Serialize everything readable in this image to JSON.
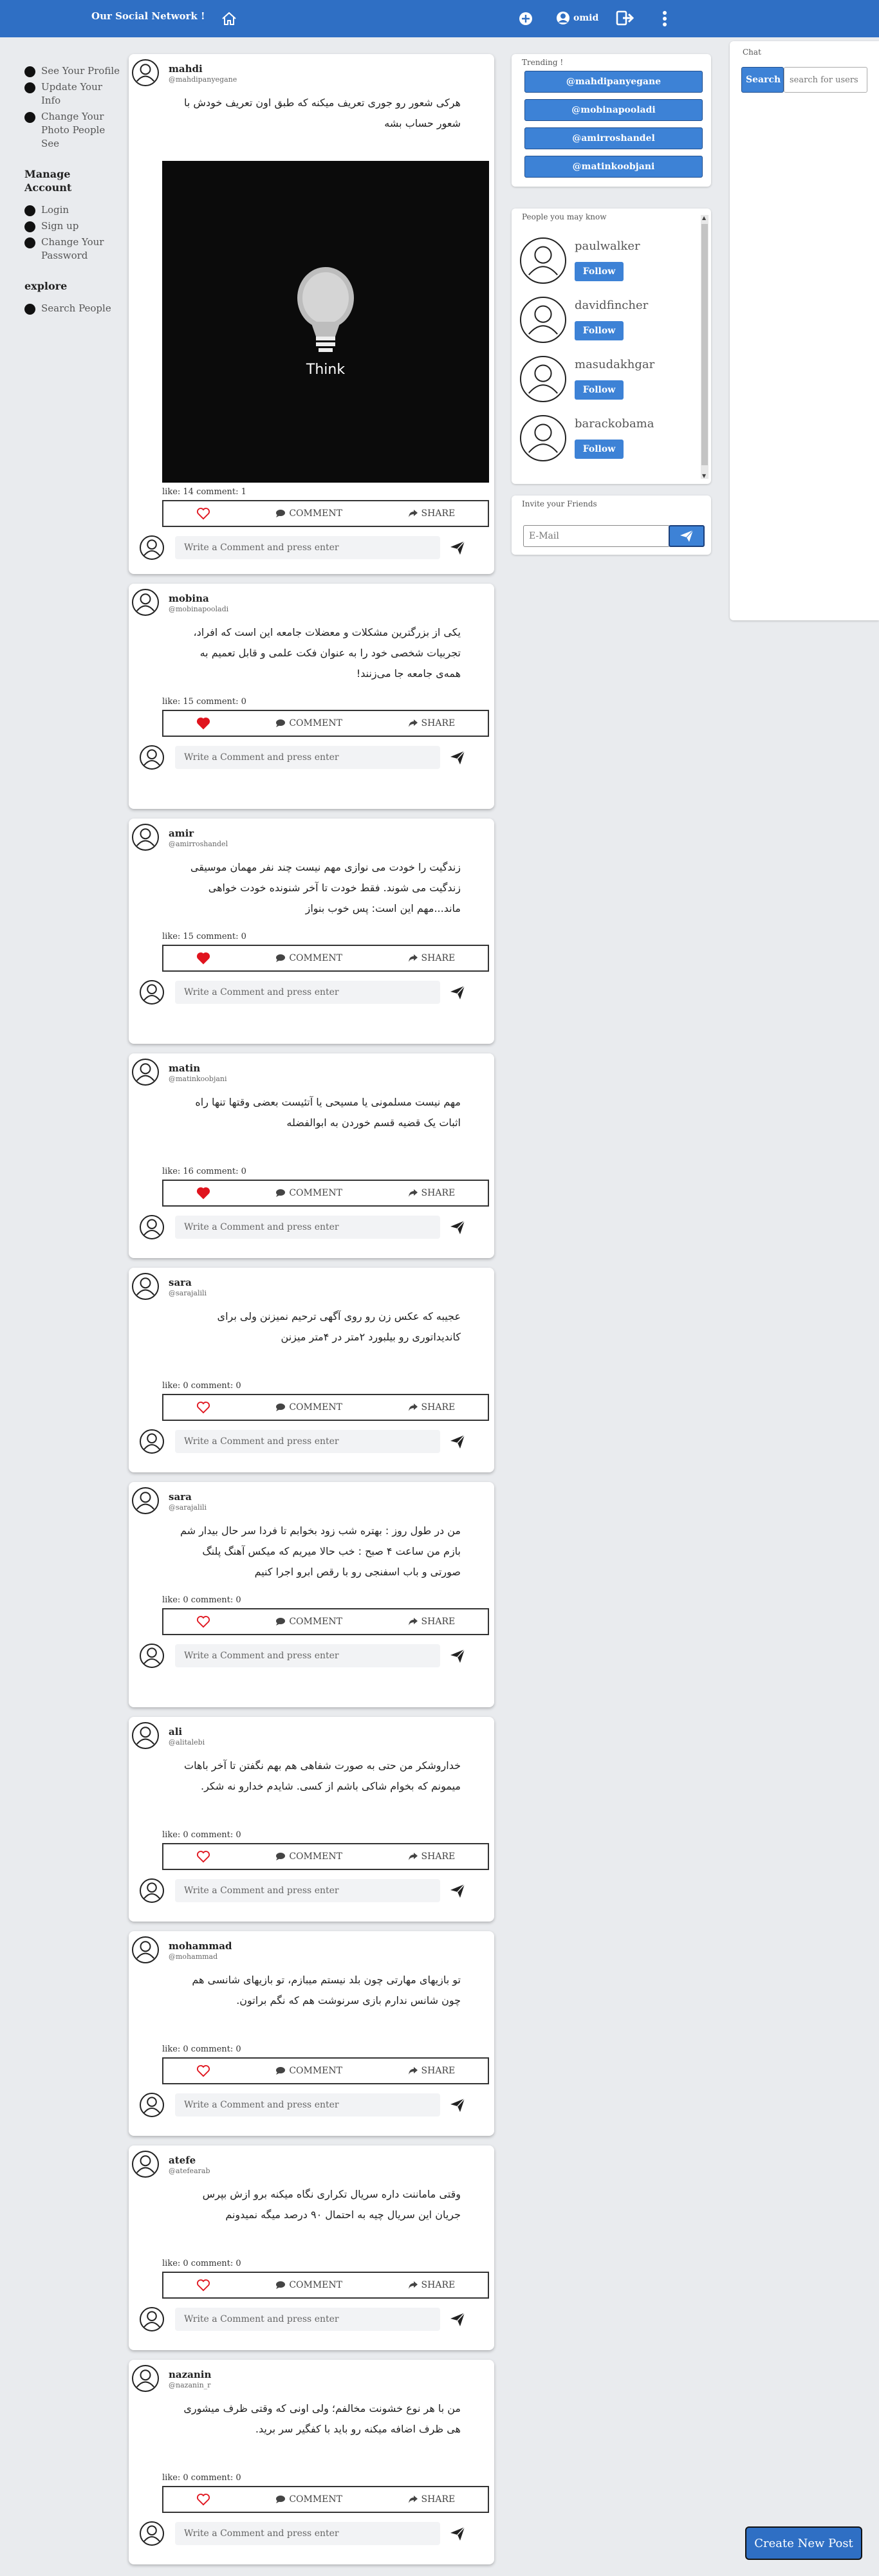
{
  "header": {
    "brand": "Our Social Network !",
    "username": "omid"
  },
  "sidebar": {
    "items": [
      "See Your Profile",
      "Update Your Info",
      "Change Your Photo People See"
    ],
    "manage_title": "Manage Account",
    "manage_items": [
      "Login",
      "Sign up",
      "Change Your Password"
    ],
    "explore_title": "explore",
    "explore_items": [
      "Search People"
    ]
  },
  "post_labels": {
    "comment": "COMMENT",
    "share": "SHARE",
    "comment_placeholder": "Write a Comment and press enter"
  },
  "posts": [
    {
      "name": "mahdi",
      "handle": "@mahdipanyegane",
      "text": "هرکی شعور رو جوری تعریف میکنه که طبق اون تعریف خودش با شعور حساب بشه",
      "image_caption": "Think",
      "stats": "like: 14 comment: 1",
      "liked": false
    },
    {
      "name": "mobina",
      "handle": "@mobinapooladi",
      "text": "یکی از بزرگترین مشکلات و معضلات جامعه این است که افراد، تجربیات شخصی خود را به عنوان فکت علمی و قابل تعمیم به همه‌ی جامعه جا می‌زنند!",
      "stats": "like: 15 comment: 0",
      "liked": true
    },
    {
      "name": "amir",
      "handle": "@amirroshandel",
      "text": "زندگیت را خودت می نوازی مهم نیست چند نفر مهمان موسیقی زندگیت می شوند. فقط خودت تا آخر شنونده خودت خواهی ماند...مهم این است: پس خوب بنواز",
      "stats": "like: 15 comment: 0",
      "liked": true
    },
    {
      "name": "matin",
      "handle": "@matinkoobjani",
      "text": "مهم نیست مسلمونی یا مسیحی یا آتئیست بعضی وقتها تنها راه اثبات یک قضیه قسم خوردن به ابوالفضله",
      "stats": "like: 16 comment: 0",
      "liked": true
    },
    {
      "name": "sara",
      "handle": "@sarajalili",
      "text": "عجیبه که عکس زن رو روی آگهی ترحیم نمیزنن ولی برای کاندیداتوری رو بیلبورد ۲متر در ۴متر میزنن",
      "stats": "like: 0 comment: 0",
      "liked": false
    },
    {
      "name": "sara",
      "handle": "@sarajalili",
      "text": "من در طول روز : بهتره شب زود بخوابم تا فردا سر حال بیدار شم بازم من ساعت ۴ صبح : خب حالا میریم که میکس آهنگ پلنگ صورتی و باب اسفنجی رو با رقص ابرو اجرا کنیم",
      "stats": "like: 0 comment: 0",
      "liked": false
    },
    {
      "name": "ali",
      "handle": "@alitalebi",
      "text": "خداروشکر من حتی به صورت شفاهی هم بهم نگفتن تا آخر باهات میمونم که بخوام شاکی باشم از کسی. شایدم خدارو نه شکر.",
      "stats": "like: 0 comment: 0",
      "liked": false
    },
    {
      "name": "mohammad",
      "handle": "@mohammad",
      "text": "تو بازیهای مهارتی چون بلد نیستم میبازم، تو بازیهای شانسی هم چون شانس ندارم بازی سرنوشت هم که نگم براتون.",
      "stats": "like: 0 comment: 0",
      "liked": false
    },
    {
      "name": "atefe",
      "handle": "@atefearab",
      "text": "وقتی ماماننت داره سریال تکراری نگاه میکنه برو ازش بپرس جریان این سریال چیه به احتمال ۹۰ درصد میگه نمیدونم",
      "stats": "like: 0 comment: 0",
      "liked": false
    },
    {
      "name": "nazanin",
      "handle": "@nazanin_r",
      "text": "من با هر نوع خشونت مخالفم؛ ولی اونی که وقتی ظرف میشوری هی ظرف اضافه میکنه رو باید با کفگیر سر برید.",
      "stats": "like: 0 comment: 0",
      "liked": false
    }
  ],
  "trending": {
    "title": "Trending !",
    "items": [
      "@mahdipanyegane",
      "@mobinapooladi",
      "@amirroshandel",
      "@matinkoobjani"
    ]
  },
  "people": {
    "title": "People you may know",
    "follow_label": "Follow",
    "items": [
      {
        "name": "paulwalker"
      },
      {
        "name": "davidfincher"
      },
      {
        "name": "masudakhgar"
      },
      {
        "name": "barackobama"
      }
    ]
  },
  "invite": {
    "title": "Invite your Friends",
    "placeholder": "E-Mail"
  },
  "chat": {
    "title": "Chat",
    "search_label": "Search",
    "placeholder": "search for users"
  },
  "create_post_label": "Create New Post",
  "colors": {
    "topbar": "#2f6fc4",
    "button": "#3d82d6",
    "like_red": "#e0141e",
    "background": "#e9ebee"
  }
}
